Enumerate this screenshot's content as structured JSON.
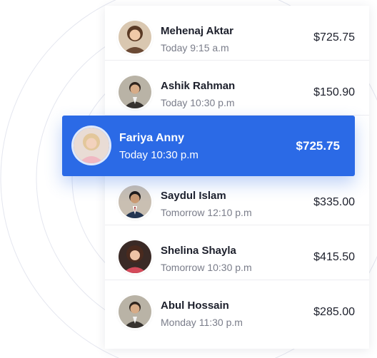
{
  "transactions": [
    {
      "name": "Mehenaj Aktar",
      "time": "Today 9:15 a.m",
      "amount": "$725.75",
      "avatar": "avatar-woman-1"
    },
    {
      "name": "Ashik Rahman",
      "time": "Today 10:30 p.m",
      "amount": "$150.90",
      "avatar": "avatar-man-1"
    },
    {
      "name": "Saydul Islam",
      "time": "Tomorrow 12:10 p.m",
      "amount": "$335.00",
      "avatar": "avatar-man-2"
    },
    {
      "name": "Shelina Shayla",
      "time": "Tomorrow 10:30 p.m",
      "amount": "$415.50",
      "avatar": "avatar-woman-2"
    },
    {
      "name": "Abul Hossain",
      "time": "Monday 11:30 p.m",
      "amount": "$285.00",
      "avatar": "avatar-man-1"
    }
  ],
  "highlighted": {
    "name": "Fariya Anny",
    "time": "Today 10:30 p.m",
    "amount": "$725.75",
    "avatar": "avatar-woman-3"
  },
  "colors": {
    "highlight": "#2b6ae6",
    "text": "#1c1f2b",
    "muted": "#7a7d8a"
  }
}
